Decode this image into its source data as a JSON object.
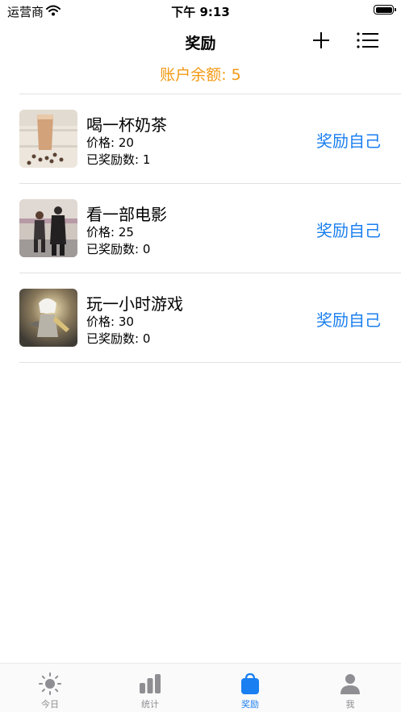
{
  "status_bar": {
    "carrier": "运营商",
    "time": "下午 9:13"
  },
  "nav": {
    "title": "奖励"
  },
  "balance": {
    "label": "账户余额:",
    "value": "5"
  },
  "rewards": [
    {
      "title": "喝一杯奶茶",
      "price_label": "价格:",
      "price": "20",
      "count_label": "已奖励数:",
      "count": "1",
      "action": "奖励自己"
    },
    {
      "title": "看一部电影",
      "price_label": "价格:",
      "price": "25",
      "count_label": "已奖励数:",
      "count": "0",
      "action": "奖励自己"
    },
    {
      "title": "玩一小时游戏",
      "price_label": "价格:",
      "price": "30",
      "count_label": "已奖励数:",
      "count": "0",
      "action": "奖励自己"
    }
  ],
  "tabs": [
    {
      "label": "今日",
      "icon": "sun-icon"
    },
    {
      "label": "统计",
      "icon": "bar-chart-icon"
    },
    {
      "label": "奖励",
      "icon": "bag-icon",
      "active": true
    },
    {
      "label": "我",
      "icon": "person-icon"
    }
  ],
  "colors": {
    "accent": "#1a7ff0",
    "balance": "#f29a15",
    "inactive": "#8e8e93"
  }
}
